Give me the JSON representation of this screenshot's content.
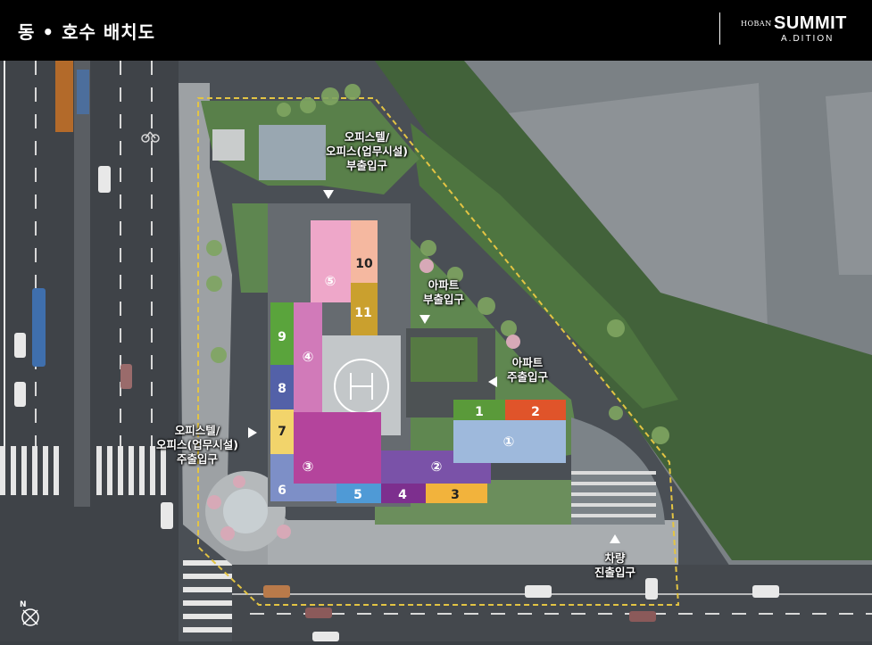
{
  "header": {
    "title": "동 • 호수 배치도",
    "logo": {
      "small": "HOBAN",
      "brand": "SUMMIT",
      "sub": "A.DITION"
    }
  },
  "units": [
    {
      "label": "①",
      "color": "#9eb9dc"
    },
    {
      "label": "②",
      "color": "#7a52a8"
    },
    {
      "label": "③",
      "color": "#b4449c"
    },
    {
      "label": "④",
      "color": "#d17ab9"
    },
    {
      "label": "⑤",
      "color": "#eea7c9"
    },
    {
      "label": "1",
      "color": "#5a9a3a"
    },
    {
      "label": "2",
      "color": "#e0542a"
    },
    {
      "label": "3",
      "color": "#f2b33c"
    },
    {
      "label": "4",
      "color": "#7d2f8e"
    },
    {
      "label": "5",
      "color": "#4f9ad6"
    },
    {
      "label": "6",
      "color": "#7d8fc7"
    },
    {
      "label": "7",
      "color": "#f2d46b"
    },
    {
      "label": "8",
      "color": "#5361a8"
    },
    {
      "label": "9",
      "color": "#5aa43c"
    },
    {
      "label": "10",
      "color": "#f5b8a0"
    },
    {
      "label": "11",
      "color": "#caa02e"
    }
  ],
  "entrances": {
    "officetel_sub": {
      "line1": "오피스텔/",
      "line2": "오피스(업무시설)",
      "line3": "부출입구"
    },
    "apt_sub": {
      "line1": "아파트",
      "line2": "부출입구"
    },
    "apt_main": {
      "line1": "아파트",
      "line2": "주출입구"
    },
    "officetel_main": {
      "line1": "오피스텔/",
      "line2": "오피스(업무시설)",
      "line3": "주출입구"
    },
    "vehicle": {
      "line1": "차량",
      "line2": "진출입구"
    }
  },
  "compass": {
    "letter": "N"
  },
  "icons": [
    "compass-icon",
    "bicycle-icon",
    "helipad-icon"
  ]
}
